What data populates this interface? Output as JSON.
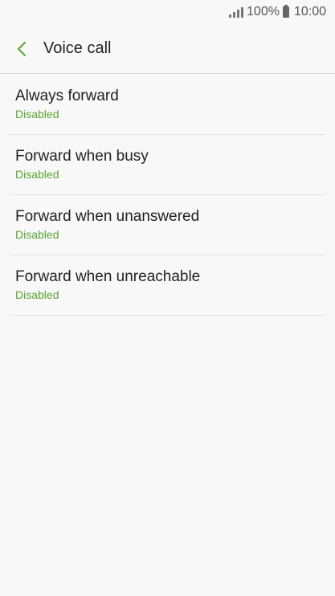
{
  "status_bar": {
    "battery_percent": "100%",
    "time": "10:00"
  },
  "header": {
    "title": "Voice call",
    "back_icon": "chevron-left-icon"
  },
  "settings": [
    {
      "title": "Always forward",
      "status": "Disabled"
    },
    {
      "title": "Forward when busy",
      "status": "Disabled"
    },
    {
      "title": "Forward when unanswered",
      "status": "Disabled"
    },
    {
      "title": "Forward when unreachable",
      "status": "Disabled"
    }
  ],
  "colors": {
    "accent": "#5aa532",
    "background": "#f8f8f8",
    "text": "#222222"
  }
}
